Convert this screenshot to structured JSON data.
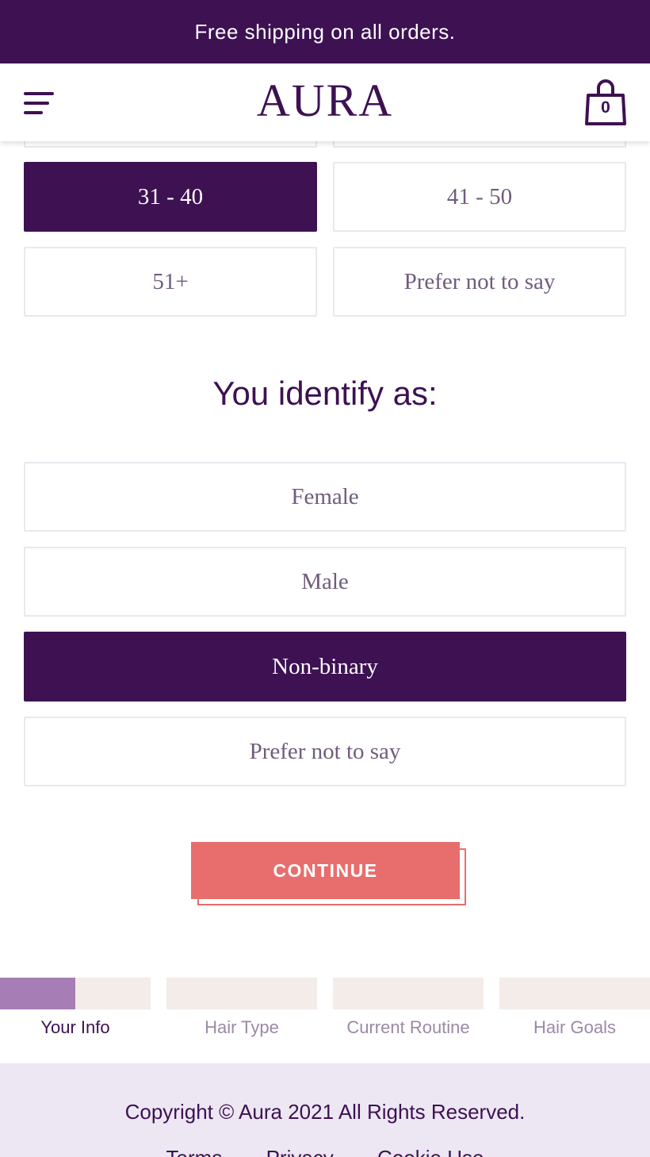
{
  "announcement": "Free shipping on all orders.",
  "header": {
    "logo": "AURA",
    "cart_count": "0"
  },
  "age_options": [
    "31 - 40",
    "41 - 50",
    "51+",
    "Prefer not to say"
  ],
  "age_selected": "31 - 40",
  "identity": {
    "title": "You identify as:",
    "options": [
      "Female",
      "Male",
      "Non-binary",
      "Prefer not to say"
    ],
    "selected": "Non-binary"
  },
  "continue_label": "CONTINUE",
  "progress": {
    "steps": [
      "Your Info",
      "Hair Type",
      "Current Routine",
      "Hair Goals"
    ],
    "active_step": "Your Info",
    "active_step_fraction": 0.5
  },
  "footer": {
    "copyright": "Copyright © Aura 2021 All Rights Reserved.",
    "links": [
      "Terms",
      "Privacy",
      "Cookie Use"
    ]
  },
  "colors": {
    "brand": "#3d1152",
    "accent": "#e86e6e",
    "progress": "#a67db5"
  }
}
